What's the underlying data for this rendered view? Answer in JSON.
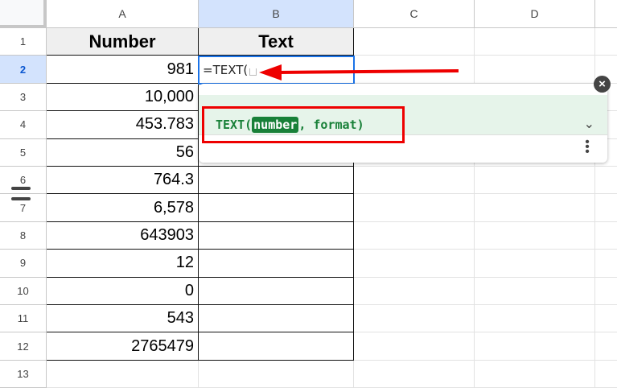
{
  "columns": [
    "A",
    "B",
    "C",
    "D"
  ],
  "rows": [
    "1",
    "2",
    "3",
    "4",
    "5",
    "6",
    "7",
    "8",
    "9",
    "10",
    "11",
    "12",
    "13"
  ],
  "headers": {
    "a1": "Number",
    "b1": "Text"
  },
  "numbers": [
    "981",
    "10,000",
    "453.783",
    "56",
    "764.3",
    "6,578",
    "643903",
    "12",
    "0",
    "543",
    "2765479"
  ],
  "active_cell": {
    "formula": "=TEXT("
  },
  "autocomplete": {
    "fn": "TEXT(",
    "param_active": "number",
    "rest": ", format)"
  },
  "icons": [
    "close-icon",
    "chevron-down-icon",
    "more-vert-icon",
    "row-resize-icon",
    "red-arrow"
  ],
  "colors": {
    "accent": "#1a73e8",
    "highlight": "#188038",
    "annotation": "#e00000"
  }
}
